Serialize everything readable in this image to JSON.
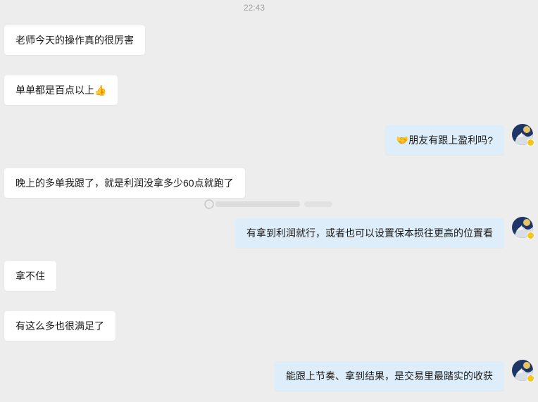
{
  "chat": {
    "timestamp": "22:43",
    "messages": [
      {
        "side": "left",
        "text": "老师今天的操作真的很厉害"
      },
      {
        "side": "left",
        "text": "单单都是百点以上",
        "emoji": "👍"
      },
      {
        "side": "right",
        "emoji": "🤝",
        "text": "朋友有跟上盈利吗?"
      },
      {
        "side": "left",
        "text": "晚上的多单我跟了，就是利润没拿多少60点就跑了"
      },
      {
        "side": "right",
        "text": "有拿到利润就行，或者也可以设置保本损往更高的位置看"
      },
      {
        "side": "left",
        "text": "拿不住"
      },
      {
        "side": "left",
        "text": "有这么多也很满足了"
      },
      {
        "side": "right",
        "text": "能跟上节奏、拿到结果，是交易里最踏实的收获"
      }
    ]
  },
  "colors": {
    "background": "#ededed",
    "left_bubble": "#ffffff",
    "right_bubble": "#ddeefa",
    "text": "#1a1a1a",
    "timestamp": "#a3a3a3",
    "badge": "#f5c518"
  },
  "icons": {
    "avatar": "avatar-icon",
    "badge": "verified-badge-icon"
  }
}
